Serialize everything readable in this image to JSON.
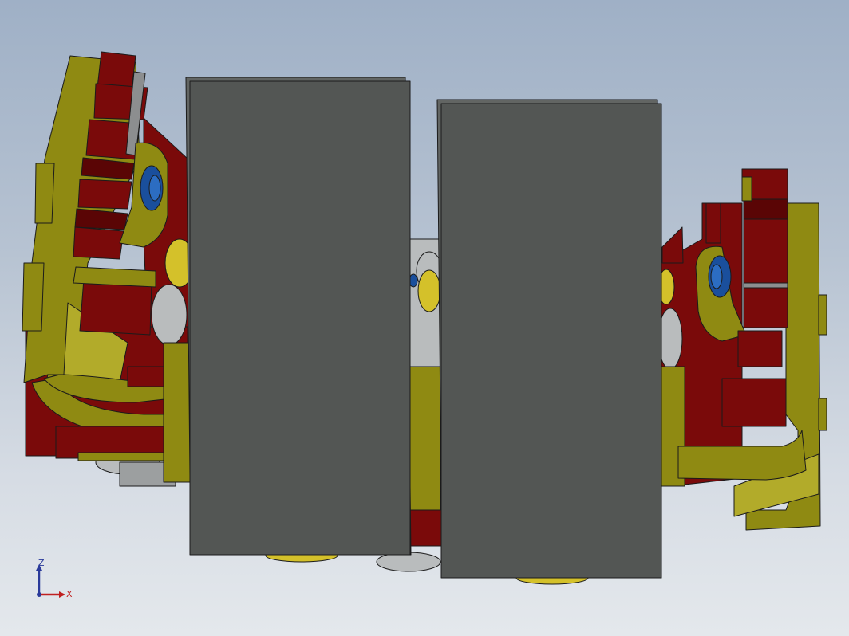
{
  "viewport": {
    "background_top": "#9fb0c6",
    "background_bottom": "#e4e8ec"
  },
  "model": {
    "colors": {
      "frame_yellow": "#8f8a12",
      "frame_yellow_light": "#b2ab2a",
      "frame_yellow_dark": "#6e6a0c",
      "body_red": "#7a0a0a",
      "body_red_dark": "#5a0505",
      "body_red_light": "#93140f",
      "wheel_gray": "#535654",
      "roller_silver": "#b9bcbd",
      "bolt_blue": "#1a4f9c",
      "edge": "#1b1b1b"
    },
    "parts": [
      "left-gripper-assembly",
      "left-wheel",
      "center-hub",
      "right-wheel",
      "right-gripper-assembly"
    ]
  },
  "triad": {
    "icon": "coordinate-axes-icon",
    "z_label": "Z",
    "x_label": "X",
    "z_color": "#2a3a9a",
    "x_color": "#c02020"
  }
}
